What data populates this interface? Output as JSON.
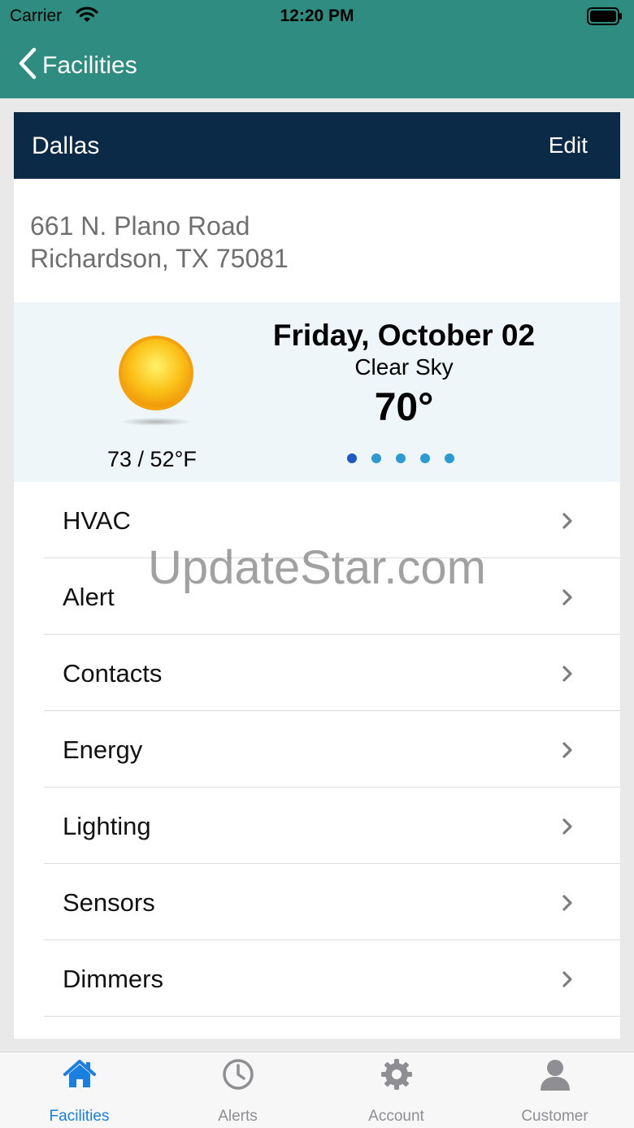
{
  "status_bar": {
    "carrier": "Carrier",
    "time": "12:20 PM"
  },
  "nav": {
    "back_label": "Facilities"
  },
  "facility": {
    "name": "Dallas",
    "edit_label": "Edit",
    "address_line1": "661 N. Plano Road",
    "address_line2": "Richardson, TX 75081"
  },
  "weather": {
    "icon": "sun-icon",
    "day": "Friday, October 02",
    "condition": "Clear Sky",
    "temperature": "70°",
    "range": "73 / 52°F",
    "page_count": 5,
    "active_page": 1
  },
  "menu": {
    "items": [
      {
        "label": "HVAC"
      },
      {
        "label": "Alert"
      },
      {
        "label": "Contacts"
      },
      {
        "label": "Energy"
      },
      {
        "label": "Lighting"
      },
      {
        "label": "Sensors"
      },
      {
        "label": "Dimmers"
      }
    ]
  },
  "watermark": "UpdateStar.com",
  "tabbar": {
    "tabs": [
      {
        "label": "Facilities",
        "icon": "home-icon",
        "active": true
      },
      {
        "label": "Alerts",
        "icon": "clock-icon",
        "active": false
      },
      {
        "label": "Account",
        "icon": "gear-icon",
        "active": false
      },
      {
        "label": "Customer",
        "icon": "person-icon",
        "active": false
      }
    ]
  },
  "colors": {
    "header_teal": "#2e8d80",
    "card_header_navy": "#0b2a47",
    "tab_active_blue": "#1a7fe0",
    "weather_bg": "#eef6f9"
  }
}
